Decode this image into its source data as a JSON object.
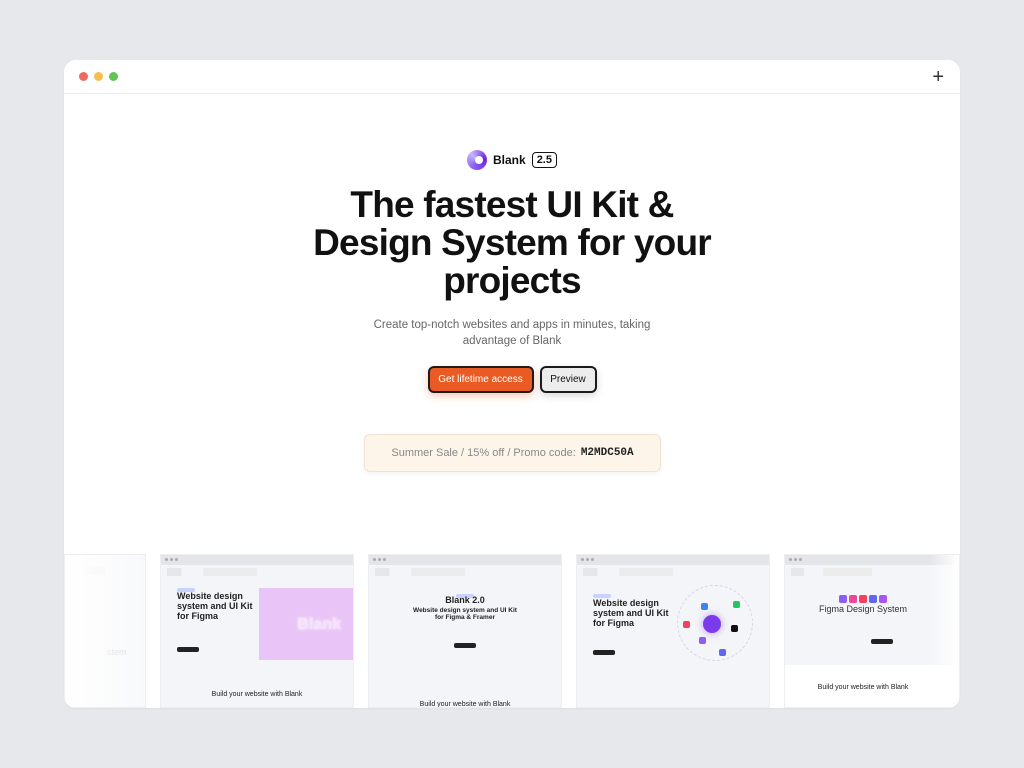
{
  "window": {
    "new_tab": "+"
  },
  "brand": {
    "name": "Blank",
    "version": "2.5",
    "icon": "blank-logo-icon"
  },
  "hero": {
    "line1": "The fastest UI Kit &",
    "line2": "Design System for your",
    "line3": "projects"
  },
  "subtitle": {
    "line1": "Create top-notch websites and apps in minutes,  taking",
    "line2": "advantage of Blank"
  },
  "buttons": {
    "primary": "Get lifetime access",
    "secondary": "Preview"
  },
  "promo": {
    "text": "Summer Sale  /  15% off  /  Promo code:",
    "code": "M2MDC50A"
  },
  "thumbs": [
    {
      "title_lines": [
        "",
        "stem"
      ]
    },
    {
      "title_lines": [
        "Website design",
        "system and UI Kit",
        "for Figma"
      ],
      "overlay": "Blank",
      "footer": "Build your website with Blank"
    },
    {
      "title_lines": [
        "Blank 2.0",
        "Website design system and UI Kit",
        "for Figma & Framer"
      ],
      "footer": "Build your website with Blank"
    },
    {
      "title_lines": [
        "Website design",
        "system and UI Kit",
        "for Figma"
      ]
    },
    {
      "title_lines": [
        "Figma Design System"
      ],
      "footer": "Build your website with Blank"
    }
  ],
  "colors": {
    "accent": "#ea5b24",
    "promo_bg": "#fdf5ea",
    "brand_purple": "#7c3aed"
  }
}
